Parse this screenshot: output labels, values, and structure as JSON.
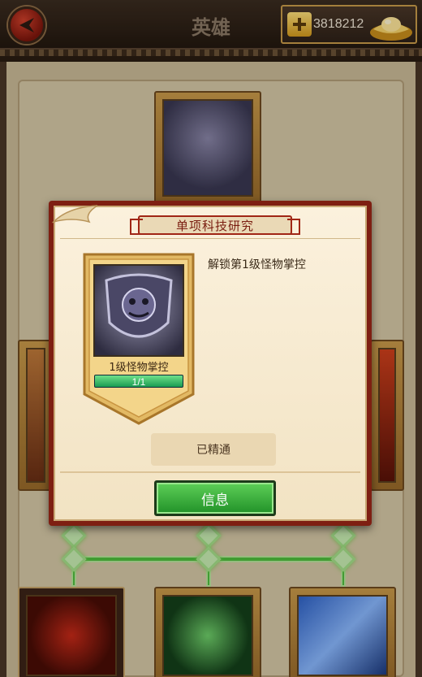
{
  "header": {
    "title": "英雄",
    "gold_amount": "3818212",
    "back_icon": "back-arrow-icon",
    "add_icon": "plus-icon",
    "currency_icon": "gold-ingot-icon"
  },
  "tree": {
    "cards": [
      {
        "id": "top-center",
        "label": "1级怪物掌控",
        "style": "purple-shield"
      },
      {
        "id": "mid-left",
        "style": "red-axe"
      },
      {
        "id": "mid-right",
        "style": "red-fire"
      },
      {
        "id": "bottom-left",
        "style": "red-shield"
      },
      {
        "id": "bottom-center",
        "style": "green-shield"
      },
      {
        "id": "bottom-right",
        "style": "warrior"
      }
    ]
  },
  "dialog": {
    "title": "单项科技研究",
    "description": "解锁第1级怪物掌控",
    "skill_name": "1级怪物掌控",
    "progress_text": "1/1",
    "progress_fraction": 1.0,
    "status_label": "已精通",
    "info_button_label": "信息"
  },
  "colors": {
    "accent_green": "#2fa83a",
    "dialog_frame": "#7e1f12",
    "gold": "#f0c040"
  }
}
